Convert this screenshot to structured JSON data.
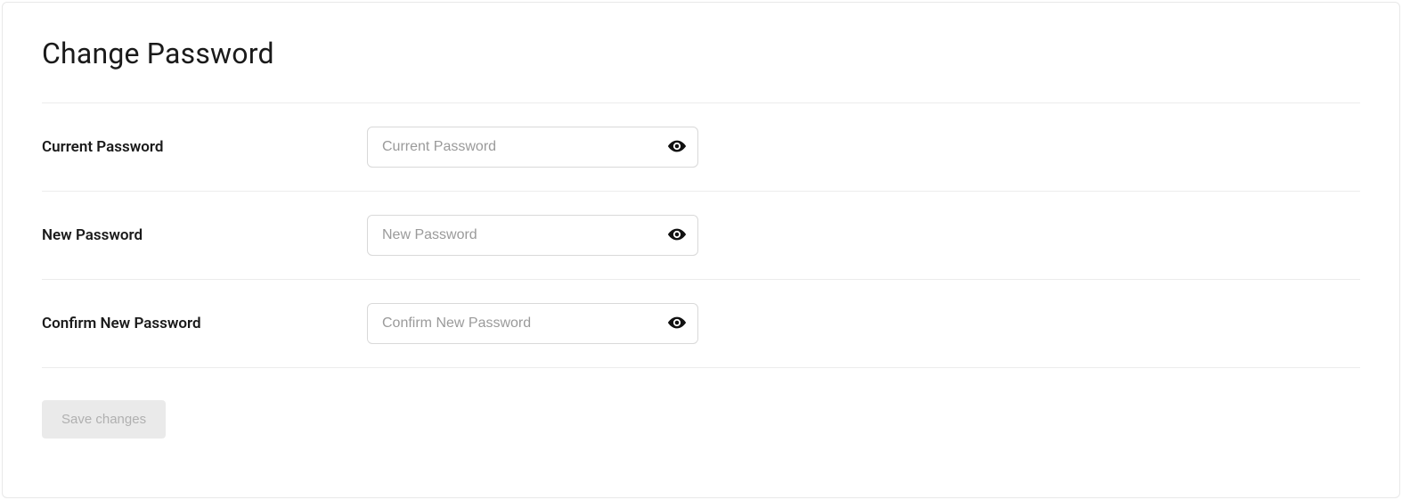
{
  "title": "Change Password",
  "fields": {
    "current": {
      "label": "Current Password",
      "placeholder": "Current Password",
      "value": ""
    },
    "new": {
      "label": "New Password",
      "placeholder": "New Password",
      "value": ""
    },
    "confirm": {
      "label": "Confirm New Password",
      "placeholder": "Confirm New Password",
      "value": ""
    }
  },
  "actions": {
    "save_label": "Save changes",
    "save_enabled": false
  }
}
